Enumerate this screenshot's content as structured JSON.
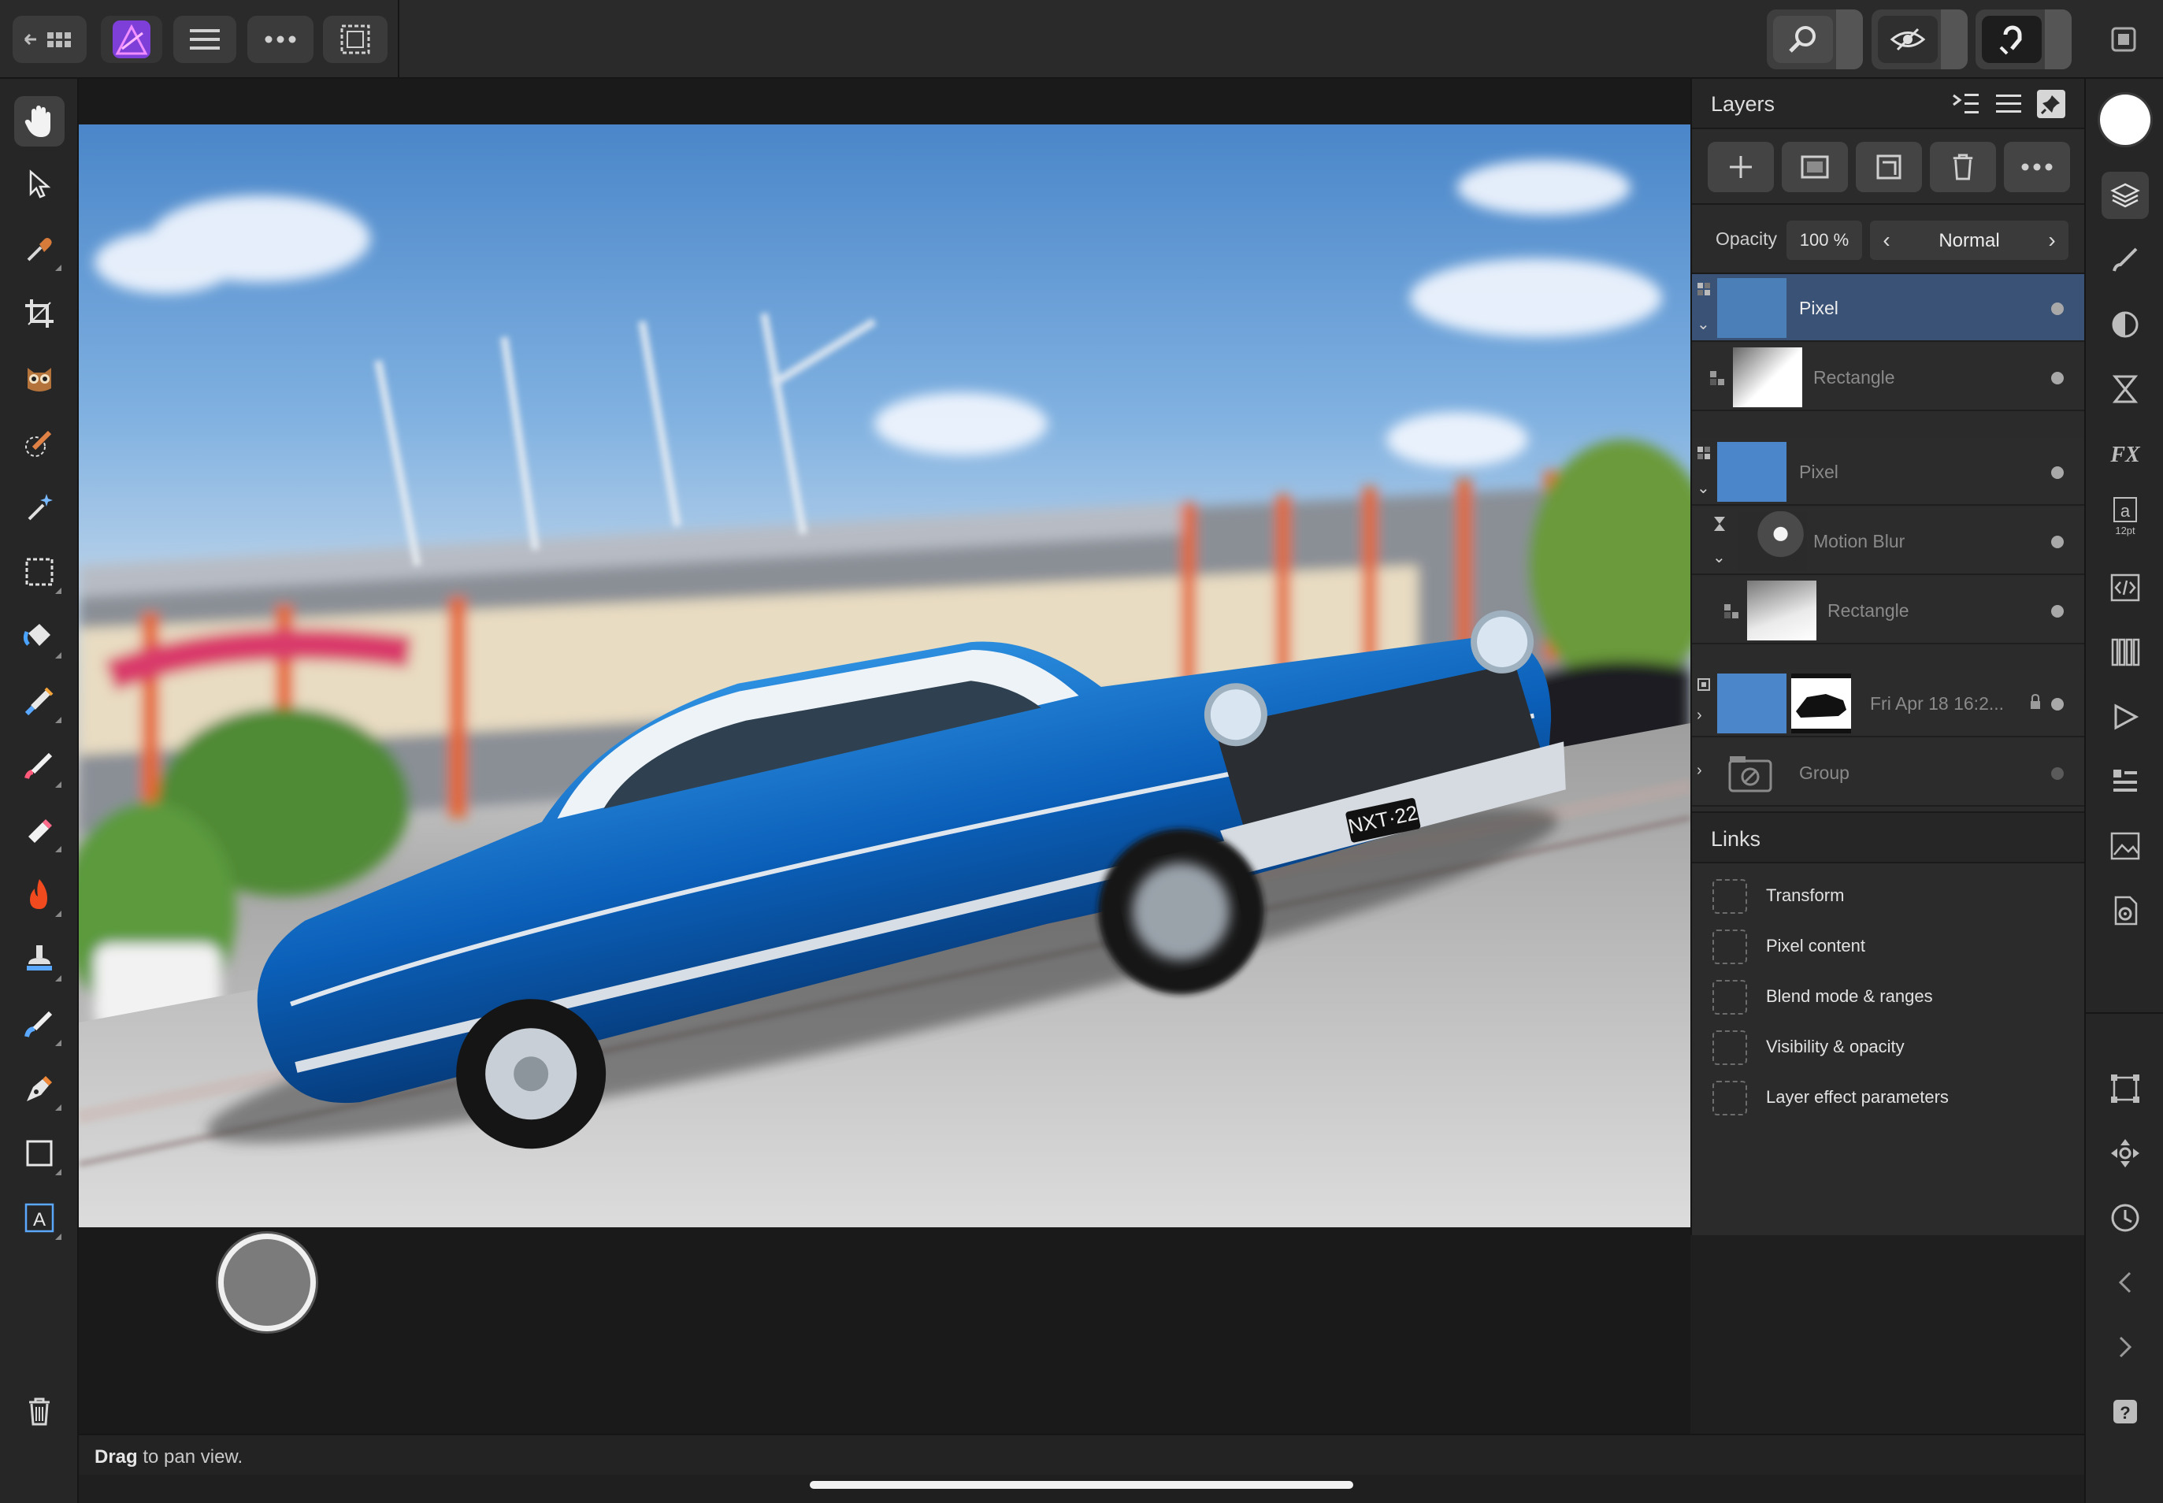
{
  "app": {
    "name": "Affinity Photo",
    "accent": "#9b4dff"
  },
  "topbar": {
    "left_buttons": [
      {
        "name": "back-grid-button",
        "icon": "back-grid-icon"
      },
      {
        "name": "app-persona-button",
        "icon": "affinity-photo-logo"
      },
      {
        "name": "menu-button",
        "icon": "hamburger-icon"
      },
      {
        "name": "more-button",
        "icon": "more-dots-icon"
      },
      {
        "name": "selection-button",
        "icon": "marquee-selection-icon"
      }
    ],
    "right_buttons": [
      {
        "name": "zoom-view-button",
        "icon": "magnifier-icon"
      },
      {
        "name": "quickmask-button",
        "icon": "eye-mask-icon"
      },
      {
        "name": "snapping-button",
        "icon": "magnet-icon"
      },
      {
        "name": "fullscreen-button",
        "icon": "fullscreen-icon"
      }
    ]
  },
  "left_tools": [
    {
      "id": "hand",
      "icon": "hand-icon",
      "active": true
    },
    {
      "id": "move",
      "icon": "move-arrow-icon"
    },
    {
      "id": "color-picker",
      "icon": "eyedropper-icon"
    },
    {
      "id": "crop",
      "icon": "crop-icon"
    },
    {
      "id": "red-eye",
      "icon": "owl-icon"
    },
    {
      "id": "selection-brush",
      "icon": "selection-brush-icon"
    },
    {
      "id": "magic-wand",
      "icon": "magic-wand-icon"
    },
    {
      "id": "marquee",
      "icon": "marquee-icon"
    },
    {
      "id": "fill",
      "icon": "paint-bucket-icon"
    },
    {
      "id": "paint-mixer",
      "icon": "mixer-brush-icon"
    },
    {
      "id": "paint-brush",
      "icon": "paint-brush-icon"
    },
    {
      "id": "erase",
      "icon": "eraser-icon"
    },
    {
      "id": "burn",
      "icon": "flame-icon"
    },
    {
      "id": "clone",
      "icon": "stamp-icon"
    },
    {
      "id": "retouch",
      "icon": "healing-brush-icon"
    },
    {
      "id": "pen",
      "icon": "pen-nib-icon"
    },
    {
      "id": "rectangle",
      "icon": "rectangle-icon"
    },
    {
      "id": "text",
      "icon": "text-frame-icon"
    },
    {
      "id": "delete",
      "icon": "trash-icon"
    }
  ],
  "status": {
    "bold": "Drag",
    "rest": " to pan view."
  },
  "layers_panel": {
    "title": "Layers",
    "opacity_label": "Opacity",
    "opacity_value": "100 %",
    "blend_mode": "Normal",
    "layers": [
      {
        "name": "Pixel",
        "selected": true,
        "indent": 0,
        "expander": "v",
        "type_icon": "link-icon"
      },
      {
        "name": "Rectangle",
        "dim": true,
        "indent": 1,
        "type_icon": "mask-icon",
        "thumb": "white-gradient"
      },
      {
        "name": "Pixel",
        "dim": true,
        "indent": 0,
        "expander": "v",
        "type_icon": "link-icon"
      },
      {
        "name": "Motion Blur",
        "dim": true,
        "indent": 1,
        "expander": "v",
        "type_icon": "hourglass-icon",
        "thumb": "dark-ball"
      },
      {
        "name": "Rectangle",
        "dim": true,
        "indent": 2,
        "type_icon": "mask-icon",
        "thumb": "white-gradient"
      },
      {
        "name": "Fri Apr 18 16:2...",
        "dim": true,
        "indent": 0,
        "expander": ">",
        "type_icon": "image-layer-icon",
        "locked": true,
        "mask": true
      },
      {
        "name": "Group",
        "dim": true,
        "indent": 0,
        "expander": ">",
        "type_icon": "group-icon",
        "dot_dim": true
      }
    ]
  },
  "links_panel": {
    "title": "Links",
    "items": [
      "Transform",
      "Pixel content",
      "Blend mode & ranges",
      "Visibility & opacity",
      "Layer effect parameters"
    ]
  },
  "studio_icons": [
    {
      "id": "layers",
      "icon": "layers-icon",
      "active": true
    },
    {
      "id": "brushes",
      "icon": "brush-icon"
    },
    {
      "id": "adjustments",
      "icon": "adjustment-icon"
    },
    {
      "id": "live-filters",
      "icon": "hourglass-filter-icon"
    },
    {
      "id": "effects",
      "icon": "fx-icon",
      "label": "FX"
    },
    {
      "id": "text-styles",
      "icon": "text-style-icon",
      "label": "a",
      "sub": "12pt"
    },
    {
      "id": "macros",
      "icon": "code-icon"
    },
    {
      "id": "channels",
      "icon": "channels-icon"
    },
    {
      "id": "play",
      "icon": "play-icon"
    },
    {
      "id": "stock",
      "icon": "list-icon"
    },
    {
      "id": "navigator",
      "icon": "navigator-icon"
    },
    {
      "id": "settings",
      "icon": "document-settings-icon"
    },
    {
      "id": "transform",
      "icon": "transform-icon"
    },
    {
      "id": "move-panel",
      "icon": "move-cross-icon"
    },
    {
      "id": "history",
      "icon": "history-icon"
    },
    {
      "id": "undo",
      "icon": "chevron-left-icon"
    },
    {
      "id": "redo",
      "icon": "chevron-right-icon"
    },
    {
      "id": "help",
      "icon": "help-icon",
      "label": "?"
    }
  ]
}
